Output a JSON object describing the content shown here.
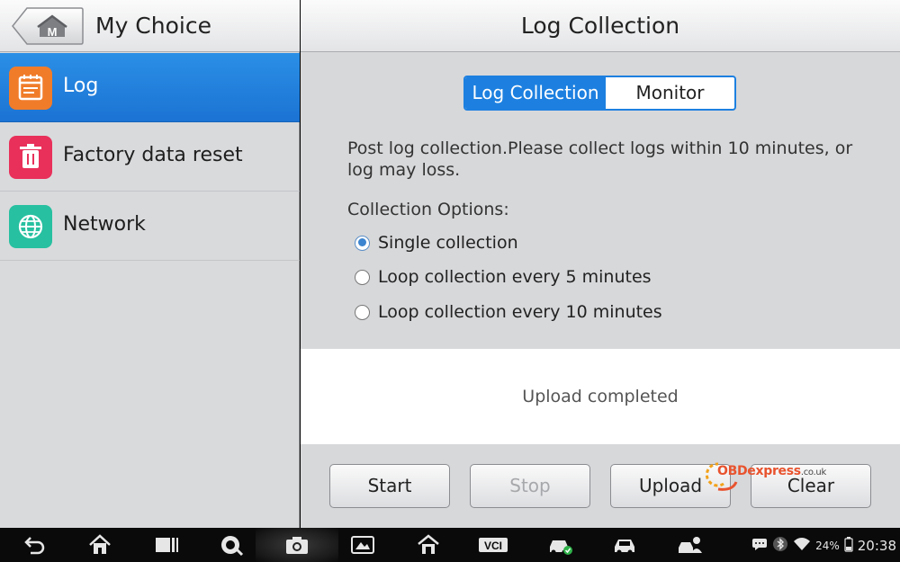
{
  "left_panel": {
    "title": "My Choice",
    "home_badge": "M",
    "items": [
      {
        "label": "Log",
        "icon": "log-icon",
        "color": "#f07c2a",
        "active": true
      },
      {
        "label": "Factory data reset",
        "icon": "trash-icon",
        "color": "#e8305a",
        "active": false
      },
      {
        "label": "Network",
        "icon": "globe-icon",
        "color": "#27c0a0",
        "active": false
      }
    ]
  },
  "main": {
    "title": "Log Collection",
    "tabs": [
      {
        "label": "Log Collection",
        "selected": true
      },
      {
        "label": "Monitor",
        "selected": false
      }
    ],
    "info_text": "Post log collection.Please collect logs within 10 minutes, or log may loss.",
    "options_title": "Collection Options:",
    "options": [
      {
        "label": "Single collection",
        "checked": true
      },
      {
        "label": "Loop collection every 5 minutes",
        "checked": false
      },
      {
        "label": "Loop collection every 10 minutes",
        "checked": false
      }
    ],
    "status": "Upload completed",
    "buttons": [
      {
        "label": "Start",
        "enabled": true
      },
      {
        "label": "Stop",
        "enabled": false
      },
      {
        "label": "Upload",
        "enabled": true
      },
      {
        "label": "Clear",
        "enabled": true
      }
    ]
  },
  "watermark": {
    "brand": "OBDexpress",
    "suffix": ".co.uk"
  },
  "navbar": {
    "icons": [
      "back-icon",
      "home-icon",
      "recent-apps-icon",
      "browser-icon",
      "camera-icon",
      "screen-icon",
      "shop-icon",
      "vci-icon",
      "car-check-icon",
      "car-icon",
      "car-service-icon"
    ],
    "vci_label": "VCI",
    "battery": "24%",
    "time": "20:38",
    "accent": "#1d80e0"
  }
}
